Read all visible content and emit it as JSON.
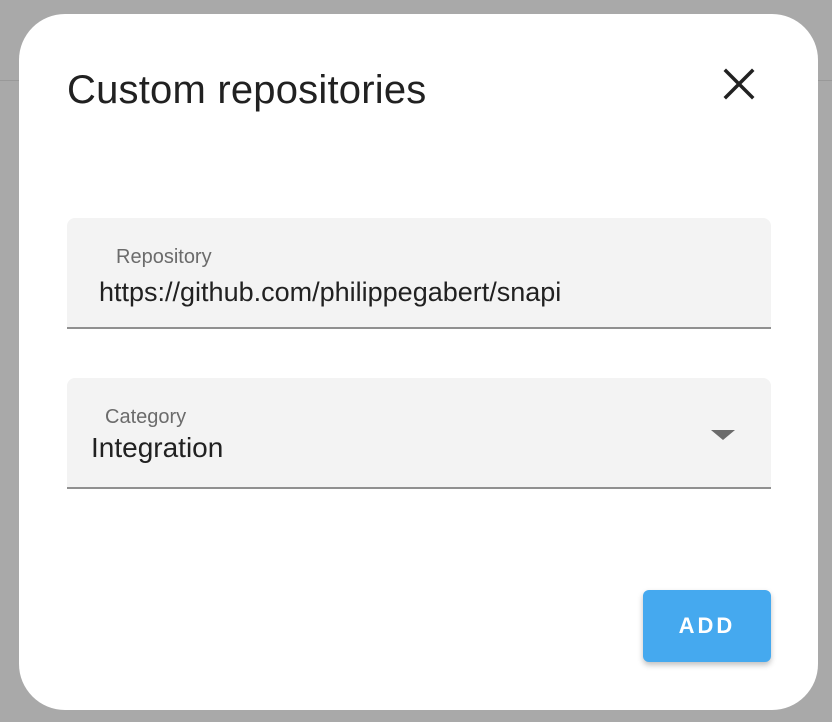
{
  "dialog": {
    "title": "Custom repositories",
    "close_icon": "close-icon"
  },
  "repository_field": {
    "label": "Repository",
    "value": "https://github.com/philippegabert/snapi"
  },
  "category_field": {
    "label": "Category",
    "selected": "Integration",
    "dropdown_icon": "arrow-drop-down-icon"
  },
  "actions": {
    "add_label": "ADD"
  },
  "colors": {
    "accent": "#45a9ef",
    "backdrop": "#a9a9a9",
    "field_background": "#f3f3f3"
  }
}
